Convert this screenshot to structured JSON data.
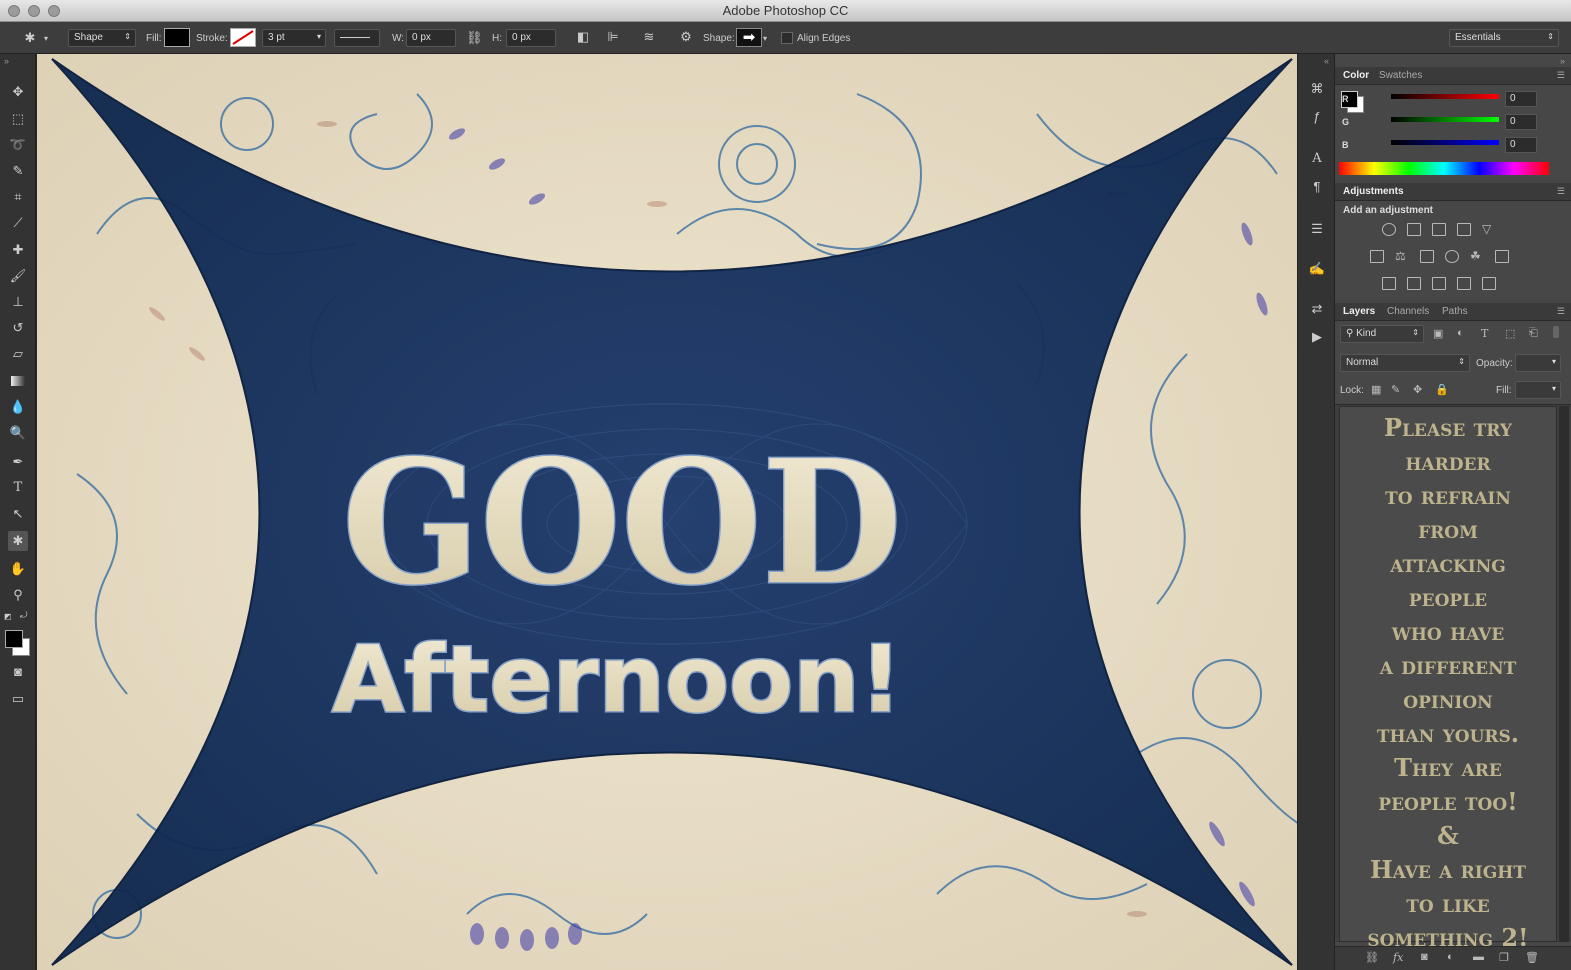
{
  "titlebar": {
    "title": "Adobe Photoshop CC"
  },
  "options": {
    "tool_mode": "Shape",
    "fill_label": "Fill:",
    "stroke_label": "Stroke:",
    "stroke_width": "3 pt",
    "w_label": "W:",
    "w_value": "0 px",
    "h_label": "H:",
    "h_value": "0 px",
    "shape_label": "Shape:",
    "align_edges_label": "Align Edges",
    "workspace": "Essentials",
    "fill_color": "#000000"
  },
  "canvas": {
    "line1": "GOOD",
    "line2": "Afternoon!",
    "shape_color": "#0f2850",
    "paper_color": "#e9e1cc"
  },
  "color_panel": {
    "tabs": [
      "Color",
      "Swatches"
    ],
    "r_label": "R",
    "r_value": "0",
    "g_label": "G",
    "g_value": "0",
    "b_label": "B",
    "b_value": "0"
  },
  "adjustments_panel": {
    "tab": "Adjustments",
    "heading": "Add an adjustment"
  },
  "layers_panel": {
    "tabs": [
      "Layers",
      "Channels",
      "Paths"
    ],
    "filter": "Kind",
    "blend_mode": "Normal",
    "opacity_label": "Opacity:",
    "lock_label": "Lock:",
    "fill_label": "Fill:",
    "poem_lines": [
      "Please try",
      "harder",
      "to refrain",
      "from",
      "attacking",
      "people",
      "who have",
      "a different",
      "opinion",
      "than yours.",
      "They are",
      "people too!",
      "&",
      "Have a right",
      "to like",
      "something 2!"
    ]
  }
}
